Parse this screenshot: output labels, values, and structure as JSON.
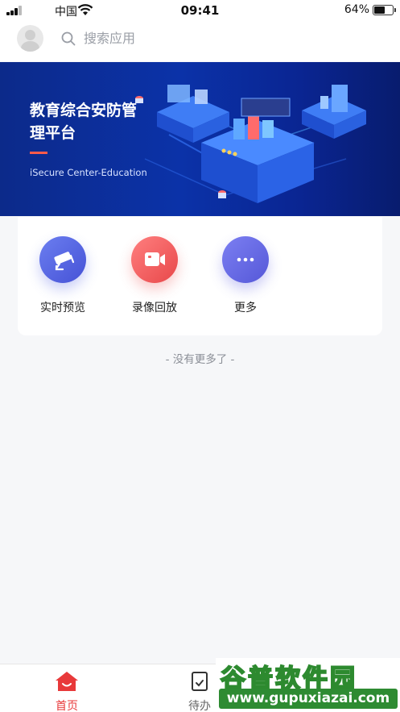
{
  "status_bar": {
    "carrier": "中国",
    "time": "09:41",
    "battery_percent": "64%",
    "battery_level": 0.64
  },
  "header": {
    "search_placeholder": "搜索应用"
  },
  "banner": {
    "title": "教育综合安防管理平台",
    "subtitle": "iSecure Center-Education"
  },
  "apps": [
    {
      "label": "实时预览",
      "icon": "camera-icon",
      "color": "#5a67e0"
    },
    {
      "label": "录像回放",
      "icon": "video-icon",
      "color": "#f06565"
    },
    {
      "label": "更多",
      "icon": "more-icon",
      "color": "#6a6de6"
    }
  ],
  "list_end_text": "- 没有更多了 -",
  "tab_bar": {
    "tabs": [
      {
        "label": "首页",
        "icon": "home-icon",
        "active": true
      },
      {
        "label": "待办",
        "icon": "todo-icon",
        "active": false
      }
    ],
    "active_color": "#e8393a"
  },
  "watermark": {
    "top": "谷普软件园",
    "bottom": "www.gupuxiazai.com"
  }
}
